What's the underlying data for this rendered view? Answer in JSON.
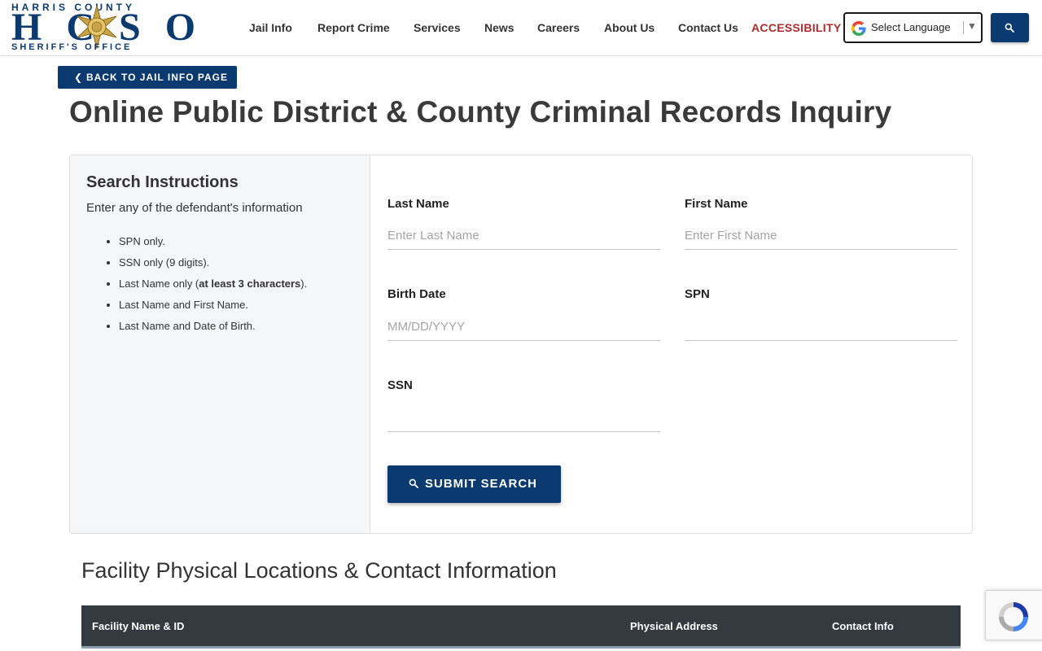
{
  "header": {
    "logo": {
      "top_text": "HARRIS COUNTY",
      "main_text": "HCSO",
      "bottom_text": "SHERIFF'S OFFICE"
    },
    "nav": [
      {
        "label": "Jail Info"
      },
      {
        "label": "Report Crime"
      },
      {
        "label": "Services"
      },
      {
        "label": "News"
      },
      {
        "label": "Careers"
      },
      {
        "label": "About Us"
      },
      {
        "label": "Contact Us"
      },
      {
        "label": "ACCESSIBILITY"
      }
    ],
    "language_select": {
      "label": "Select Language",
      "icon": "google-g-icon"
    },
    "search_button": {
      "icon": "search-icon"
    }
  },
  "back_button": {
    "label": "BACK TO JAIL INFO PAGE",
    "icon": "chevron-left-icon"
  },
  "page_title": "Online Public District & County Criminal Records Inquiry",
  "instructions": {
    "title": "Search Instructions",
    "subtitle": "Enter any of the defendant's information",
    "items": [
      {
        "text": "SPN only."
      },
      {
        "text": "SSN only (9 digits)."
      },
      {
        "prefix": "Last Name only (",
        "bold": "at least 3 characters",
        "suffix": ")."
      },
      {
        "text": "Last Name and First Name."
      },
      {
        "text": "Last Name and Date of Birth."
      }
    ]
  },
  "form": {
    "last_name": {
      "label": "Last Name",
      "placeholder": "Enter Last Name",
      "value": ""
    },
    "first_name": {
      "label": "First Name",
      "placeholder": "Enter First Name",
      "value": ""
    },
    "birth_date": {
      "label": "Birth Date",
      "placeholder": "MM/DD/YYYY",
      "value": ""
    },
    "spn": {
      "label": "SPN",
      "placeholder": "",
      "value": ""
    },
    "ssn": {
      "label": "SSN",
      "placeholder": "",
      "value": ""
    },
    "submit_label": "SUBMIT SEARCH"
  },
  "facility": {
    "title": "Facility Physical Locations & Contact Information",
    "columns": [
      "Facility Name & ID",
      "Physical Address",
      "Contact Info"
    ]
  },
  "colors": {
    "brand_blue": "#0b3a70",
    "accent_red": "#b02a2a",
    "table_header": "#343a40",
    "panel_bg": "#f4f6f8"
  }
}
